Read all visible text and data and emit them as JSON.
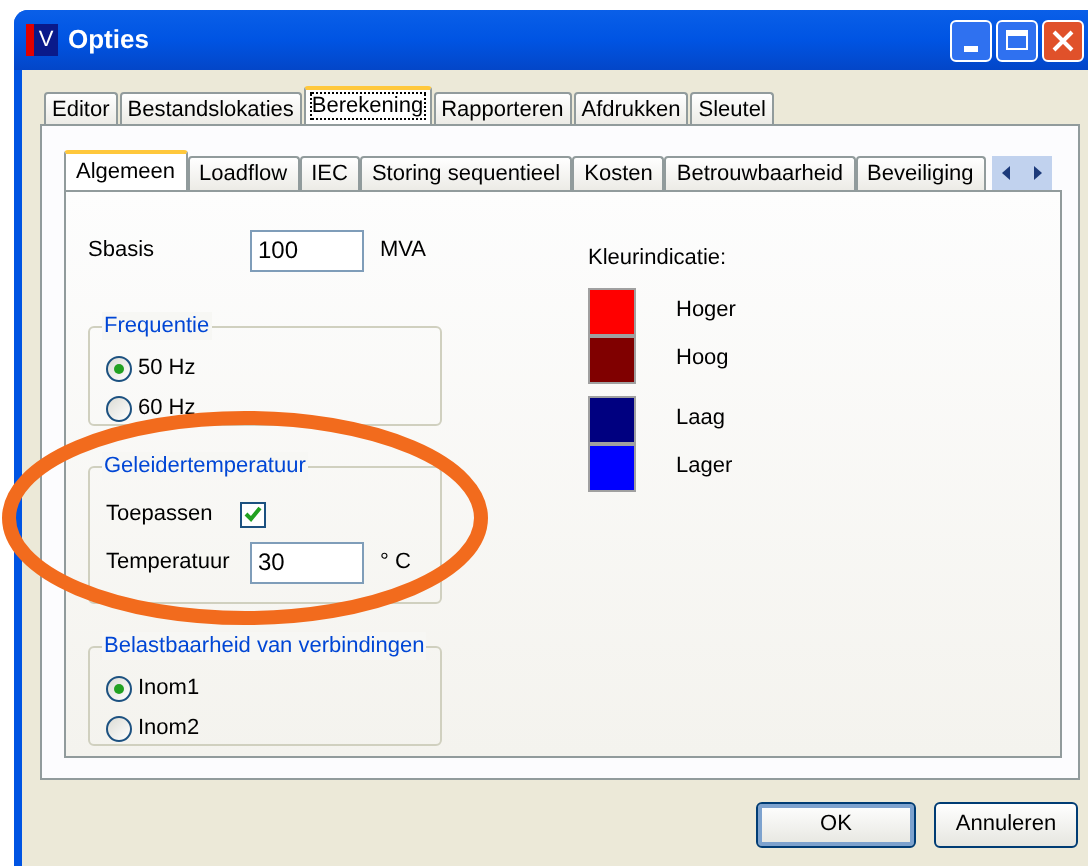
{
  "window": {
    "title": "Opties",
    "icon_letter": "V"
  },
  "tabs": [
    {
      "label": "Editor",
      "selected": false
    },
    {
      "label": "Bestandslokaties",
      "selected": false
    },
    {
      "label": "Berekening",
      "selected": true
    },
    {
      "label": "Rapporteren",
      "selected": false
    },
    {
      "label": "Afdrukken",
      "selected": false
    },
    {
      "label": "Sleutel",
      "selected": false
    }
  ],
  "subtabs": [
    {
      "label": "Algemeen",
      "selected": true
    },
    {
      "label": "Loadflow",
      "selected": false
    },
    {
      "label": "IEC",
      "selected": false
    },
    {
      "label": "Storing sequentieel",
      "selected": false
    },
    {
      "label": "Kosten",
      "selected": false
    },
    {
      "label": "Betrouwbaarheid",
      "selected": false
    },
    {
      "label": "Beveiliging",
      "selected": false
    }
  ],
  "sbasis": {
    "label": "Sbasis",
    "value": "100",
    "unit": "MVA"
  },
  "frequentie": {
    "title": "Frequentie",
    "options": [
      {
        "label": "50 Hz",
        "selected": true
      },
      {
        "label": "60 Hz",
        "selected": false
      }
    ]
  },
  "geleidertemperatuur": {
    "title": "Geleidertemperatuur",
    "toepassen": {
      "label": "Toepassen",
      "checked": true
    },
    "temperatuur": {
      "label": "Temperatuur",
      "value": "30",
      "unit": "° C"
    }
  },
  "belastbaarheid": {
    "title": "Belastbaarheid van verbindingen",
    "options": [
      {
        "label": "Inom1",
        "selected": true
      },
      {
        "label": "Inom2",
        "selected": false
      }
    ]
  },
  "kleurindicatie": {
    "title": "Kleurindicatie:",
    "items": [
      {
        "label": "Hoger",
        "color": "#ff0000"
      },
      {
        "label": "Hoog",
        "color": "#800000"
      },
      {
        "label": "Laag",
        "color": "#000080"
      },
      {
        "label": "Lager",
        "color": "#0000ff"
      }
    ]
  },
  "buttons": [
    "OK",
    "Annuleren"
  ]
}
